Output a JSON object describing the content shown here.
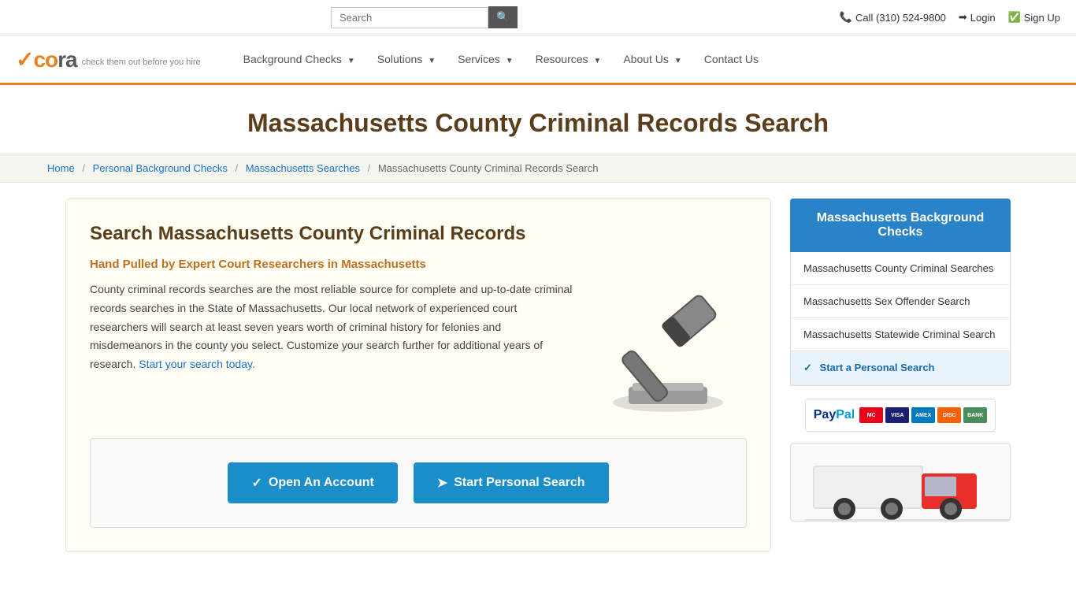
{
  "topbar": {
    "search_placeholder": "Search",
    "phone_label": "Call (310) 524-9800",
    "login_label": "Login",
    "signup_label": "Sign Up"
  },
  "navbar": {
    "logo_check": "✓co",
    "logo_rest": "ra",
    "tagline": "check them out before you hire",
    "menu": [
      {
        "label": "Background Checks",
        "has_arrow": true
      },
      {
        "label": "Solutions",
        "has_arrow": true
      },
      {
        "label": "Services",
        "has_arrow": true
      },
      {
        "label": "Resources",
        "has_arrow": true
      },
      {
        "label": "About Us",
        "has_arrow": true
      },
      {
        "label": "Contact Us",
        "has_arrow": false
      }
    ]
  },
  "page": {
    "title": "Massachusetts County Criminal Records Search",
    "breadcrumb": {
      "home": "Home",
      "step2": "Personal Background Checks",
      "step3": "Massachusetts Searches",
      "current": "Massachusetts County Criminal Records Search"
    }
  },
  "content": {
    "heading": "Search Massachusetts County Criminal Records",
    "subheading": "Hand Pulled by Expert Court Researchers in Massachusetts",
    "body": "County criminal records searches are the most reliable source for complete and up-to-date criminal records searches in the State of Massachusetts. Our local network of experienced court researchers will search at least seven years worth of criminal history for felonies and misdemeanors in the county you select. Customize your search further for additional years of research.",
    "link_text": "Start your search today.",
    "cta": {
      "open_account": "Open An Account",
      "start_search": "Start Personal Search"
    }
  },
  "sidebar": {
    "header": "Massachusetts Background Checks",
    "links": [
      {
        "label": "Massachusetts County Criminal Searches",
        "active": false
      },
      {
        "label": "Massachusetts Sex Offender Search",
        "active": false
      },
      {
        "label": "Massachusetts Statewide Criminal Search",
        "active": false
      },
      {
        "label": "Start a Personal Search",
        "active": true
      }
    ]
  }
}
